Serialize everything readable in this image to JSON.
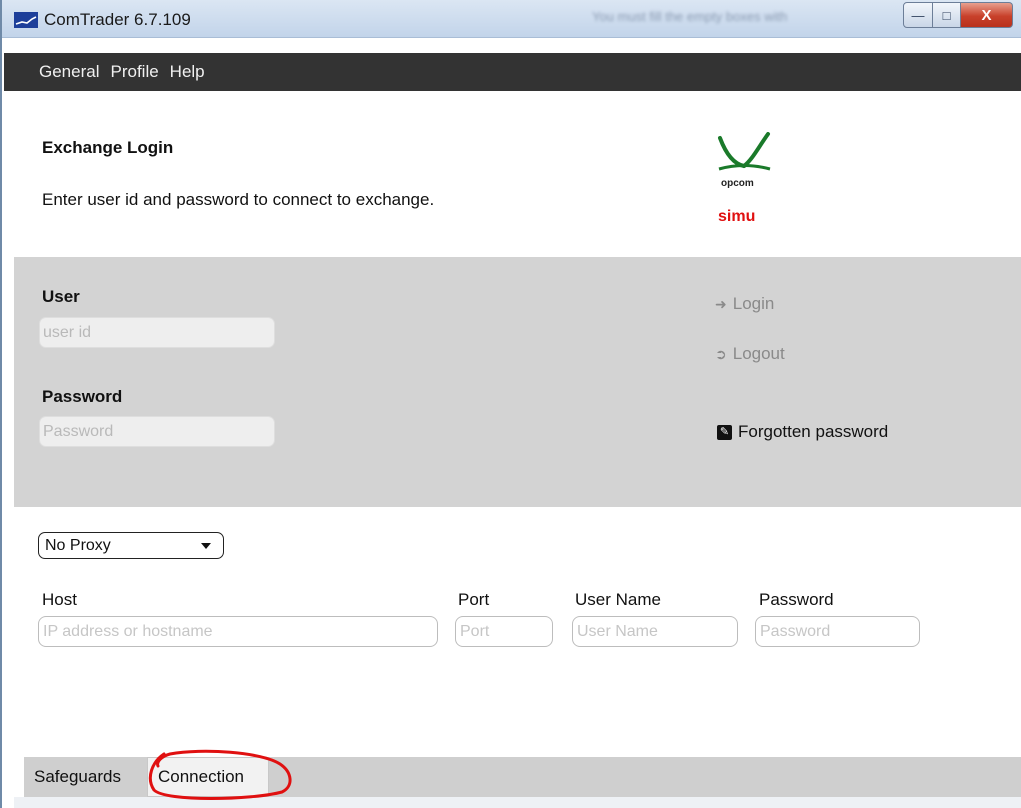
{
  "window": {
    "title": "ComTrader 6.7.109",
    "blurred_status": "You must fill the empty boxes with",
    "min_symbol": "—",
    "max_symbol": "□",
    "close_symbol": "X"
  },
  "menu": [
    "General",
    "Profile",
    "Help"
  ],
  "header": {
    "title": "Exchange Login",
    "subtitle": "Enter user id and password to connect to exchange.",
    "logo_text": "opcom",
    "environment": "simu",
    "logo_color": "#1a7a2a",
    "environment_color": "#e01010"
  },
  "login": {
    "user_label": "User",
    "user_placeholder": "user id",
    "user_value": "",
    "password_label": "Password",
    "password_placeholder": "Password",
    "password_value": "",
    "login_label": "Login",
    "login_icon": "sign-in-icon",
    "logout_label": "Logout",
    "logout_icon": "sign-out-icon",
    "forgot_label": "Forgotten password",
    "forgot_icon": "edit-icon"
  },
  "proxy": {
    "selected": "No Proxy",
    "host_label": "Host",
    "host_placeholder": "IP address or hostname",
    "port_label": "Port",
    "port_placeholder": "Port",
    "username_label": "User Name",
    "username_placeholder": "User Name",
    "password_label": "Password",
    "password_placeholder": "Password"
  },
  "tabs": [
    {
      "label": "Safeguards",
      "active": false
    },
    {
      "label": "Connection",
      "active": true
    }
  ],
  "colors": {
    "menubar": "#333333",
    "login_panel": "#d3d3d3",
    "annotation": "#e01010"
  }
}
